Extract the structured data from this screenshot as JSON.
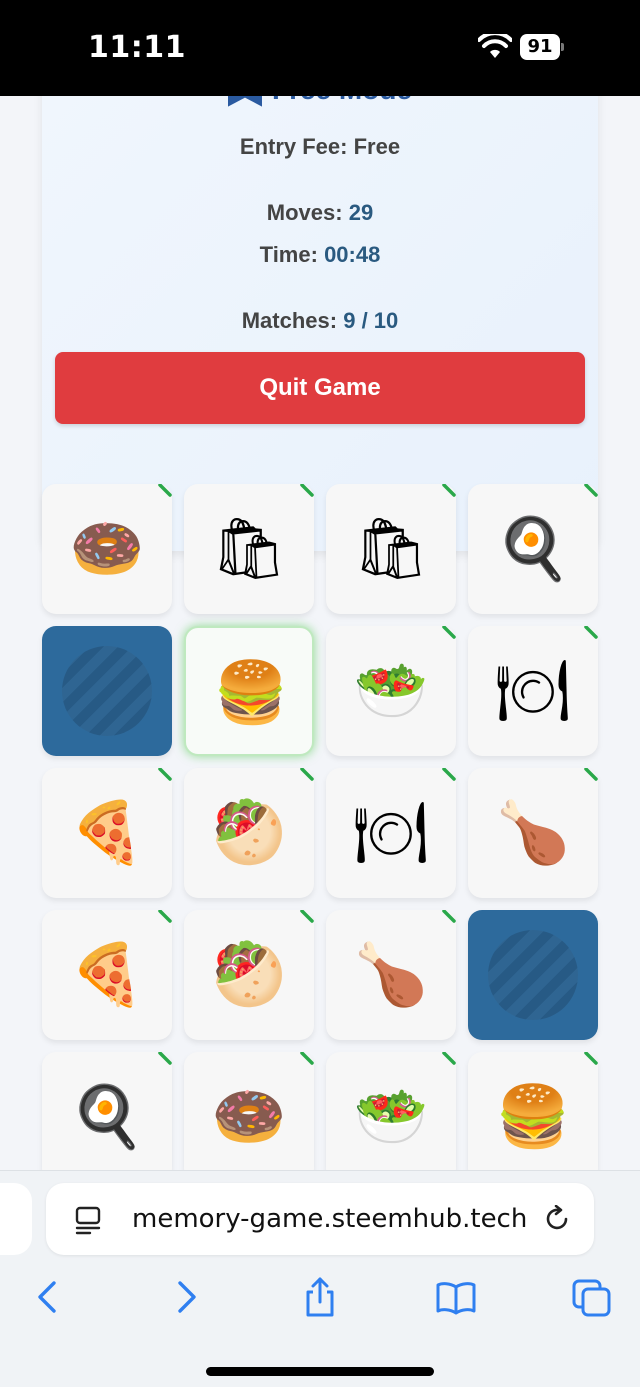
{
  "status_bar": {
    "time": "11:11",
    "battery": "91"
  },
  "game": {
    "mode_title": "Free Mode",
    "entry_fee_label": "Entry Fee:",
    "entry_fee_value": "Free",
    "moves_label": "Moves:",
    "moves_value": "29",
    "time_label": "Time:",
    "time_value": "00:48",
    "matches_label": "Matches:",
    "matches_value": "9 / 10",
    "quit_label": "Quit Game"
  },
  "cards": [
    {
      "state": "matched",
      "icon": "donut-icon",
      "glyph": "🍩"
    },
    {
      "state": "matched",
      "icon": "takeout-bag-icon",
      "glyph": "🛍"
    },
    {
      "state": "matched",
      "icon": "takeout-bag-icon",
      "glyph": "🛍"
    },
    {
      "state": "matched",
      "icon": "breakfast-pan-icon",
      "glyph": "🍳"
    },
    {
      "state": "hidden",
      "icon": "card-back-icon",
      "glyph": ""
    },
    {
      "state": "selected",
      "icon": "fast-food-icon",
      "glyph": "🍔"
    },
    {
      "state": "matched",
      "icon": "healthy-food-icon",
      "glyph": "🥗"
    },
    {
      "state": "matched",
      "icon": "plate-cutlery-icon",
      "glyph": "🍽"
    },
    {
      "state": "matched",
      "icon": "pizza-icon",
      "glyph": "🍕"
    },
    {
      "state": "matched",
      "icon": "salad-bowl-icon",
      "glyph": "🥙"
    },
    {
      "state": "matched",
      "icon": "plate-cutlery-icon",
      "glyph": "🍽"
    },
    {
      "state": "matched",
      "icon": "roast-chicken-icon",
      "glyph": "🍗"
    },
    {
      "state": "matched",
      "icon": "pizza-icon",
      "glyph": "🍕"
    },
    {
      "state": "matched",
      "icon": "salad-bowl-icon",
      "glyph": "🥙"
    },
    {
      "state": "matched",
      "icon": "roast-chicken-icon",
      "glyph": "🍗"
    },
    {
      "state": "hidden",
      "icon": "card-back-icon",
      "glyph": ""
    },
    {
      "state": "matched",
      "icon": "breakfast-pan-icon",
      "glyph": "🍳"
    },
    {
      "state": "matched",
      "icon": "donut-icon",
      "glyph": "🍩"
    },
    {
      "state": "matched",
      "icon": "healthy-food-icon",
      "glyph": "🥗"
    },
    {
      "state": "matched",
      "icon": "fast-food-icon",
      "glyph": "🍔"
    }
  ],
  "browser": {
    "url": "memory-game.steemhub.tech"
  },
  "colors": {
    "accent": "#2a5aa0",
    "quit": "#e03c3f",
    "card_back": "#2d6a9c",
    "match_mark": "#2aa84a"
  }
}
